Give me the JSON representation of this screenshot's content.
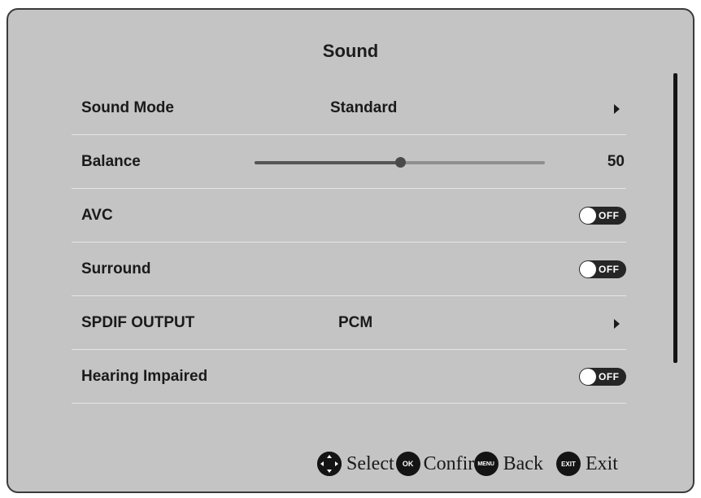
{
  "menu": {
    "title": "Sound",
    "items": [
      {
        "label": "Sound Mode",
        "type": "select",
        "value": "Standard"
      },
      {
        "label": "Balance",
        "type": "slider",
        "value": "50",
        "level": 0.5
      },
      {
        "label": "AVC",
        "type": "toggle",
        "state": "OFF"
      },
      {
        "label": "Surround",
        "type": "toggle",
        "state": "OFF"
      },
      {
        "label": "SPDIF OUTPUT",
        "type": "select",
        "value": "PCM"
      },
      {
        "label": "Hearing Impaired",
        "type": "toggle",
        "state": "OFF"
      }
    ]
  },
  "footer": {
    "select_label": "Select",
    "ok_icon_text": "OK",
    "confirm_label": "Confirm",
    "menu_icon_text": "MENU",
    "back_label": "Back",
    "exit_icon_text": "EXIT",
    "exit_label": "Exit"
  },
  "icons": {
    "navigate": "dpad-icon",
    "confirm": "ok-button-icon",
    "back": "menu-button-icon",
    "exit": "exit-button-icon",
    "submenu": "arrow-right-icon"
  },
  "colors": {
    "panel_background": "#c4c4c4",
    "toggle_off": "#262626",
    "text": "#1a1a1a"
  }
}
